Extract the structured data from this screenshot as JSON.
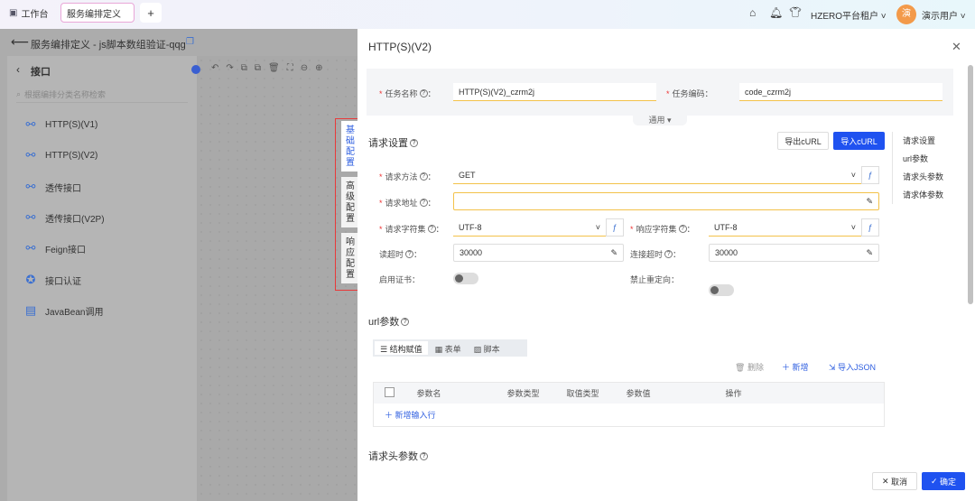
{
  "topbar": {
    "tabs": [
      {
        "label": "工作台",
        "icon": "monitor-icon"
      },
      {
        "label": "服务编排定义"
      }
    ],
    "add": "+",
    "tenant": "HZERO平台租户",
    "avatar": "演",
    "user": "演示用户"
  },
  "page": {
    "title": "服务编排定义 - js脚本数组验证-qqg",
    "panel_title": "接口",
    "search_placeholder": "根据编排分类名称检索",
    "items": [
      {
        "label": "HTTP(S)(V1)",
        "icon": "link-icon"
      },
      {
        "label": "HTTP(S)(V2)",
        "icon": "link-icon"
      },
      {
        "label": "透传接口",
        "icon": "link-icon"
      },
      {
        "label": "透传接口(V2P)",
        "icon": "link-icon"
      },
      {
        "label": "Feign接口",
        "icon": "link-icon"
      },
      {
        "label": "接口认证",
        "icon": "check-badge-icon"
      },
      {
        "label": "JavaBean调用",
        "icon": "window-icon"
      }
    ]
  },
  "vtabs": [
    "基础配置",
    "高级配置",
    "响应配置"
  ],
  "drawer": {
    "title": "HTTP(S)(V2)",
    "task_name_label": "任务名称",
    "task_name": "HTTP(S)(V2)_czrm2j",
    "task_code_label": "任务编码：",
    "task_code": "code_czrm2j",
    "general": "通用",
    "req_section": "请求设置",
    "export_curl": "导出cURL",
    "import_curl": "导入cURL",
    "anchors": [
      "请求设置",
      "url参数",
      "请求头参数",
      "请求体参数"
    ],
    "method_label": "请求方法",
    "method": "GET",
    "url_label": "请求地址",
    "url": "",
    "req_charset_label": "请求字符集",
    "req_charset": "UTF-8",
    "resp_charset_label": "响应字符集",
    "resp_charset": "UTF-8",
    "read_timeout_label": "读超时",
    "read_timeout": "30000",
    "conn_timeout_label": "连接超时",
    "conn_timeout": "30000",
    "cert_label": "启用证书：",
    "cert_enabled": false,
    "redirect_label": "禁止重定向：",
    "redirect_disabled": false,
    "url_section": "url参数",
    "seg": [
      "结构赋值",
      "表单",
      "脚本"
    ],
    "delete": "删除",
    "add": "新增",
    "import_json": "导入JSON",
    "columns": [
      "参数名",
      "参数类型",
      "取值类型",
      "参数值",
      "操作"
    ],
    "add_row": "新增输入行",
    "header_section": "请求头参数",
    "cancel": "取消",
    "confirm": "确定"
  }
}
